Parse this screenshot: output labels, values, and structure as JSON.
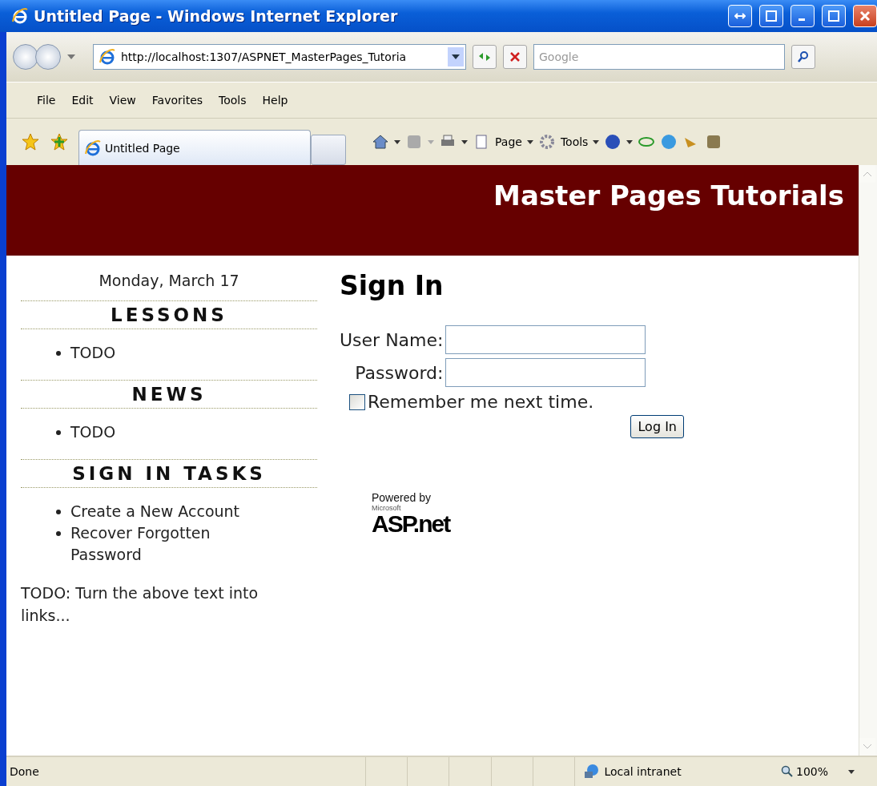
{
  "window": {
    "title": "Untitled Page - Windows Internet Explorer"
  },
  "address_bar": {
    "url": "http://localhost:1307/ASPNET_MasterPages_Tutoria"
  },
  "search": {
    "placeholder": "Google"
  },
  "menu": [
    "File",
    "Edit",
    "View",
    "Favorites",
    "Tools",
    "Help"
  ],
  "tabs": [
    {
      "label": "Untitled Page",
      "selected": true
    }
  ],
  "command_bar": [
    "Page",
    "Tools"
  ],
  "page": {
    "header": "Master Pages Tutorials",
    "date": "Monday, March 17",
    "sections": [
      {
        "title": "LESSONS",
        "items": [
          "TODO"
        ]
      },
      {
        "title": "NEWS",
        "items": [
          "TODO"
        ]
      },
      {
        "title": "SIGN IN TASKS",
        "items": [
          "Create a New Account",
          "Recover Forgotten Password"
        ]
      }
    ],
    "note": "TODO: Turn the above text into links...",
    "heading": "Sign In",
    "fields": [
      {
        "label": "User Name:"
      },
      {
        "label": "Password:"
      }
    ],
    "remember": {
      "label": "Remember me next time.",
      "checked": false
    },
    "button": "Log In",
    "logo": {
      "powered": "Powered by",
      "maker": "Microsoft",
      "name": "ASP.net"
    }
  },
  "status_bar": {
    "text": "Done",
    "zone": "Local intranet",
    "zoom": "100%"
  }
}
